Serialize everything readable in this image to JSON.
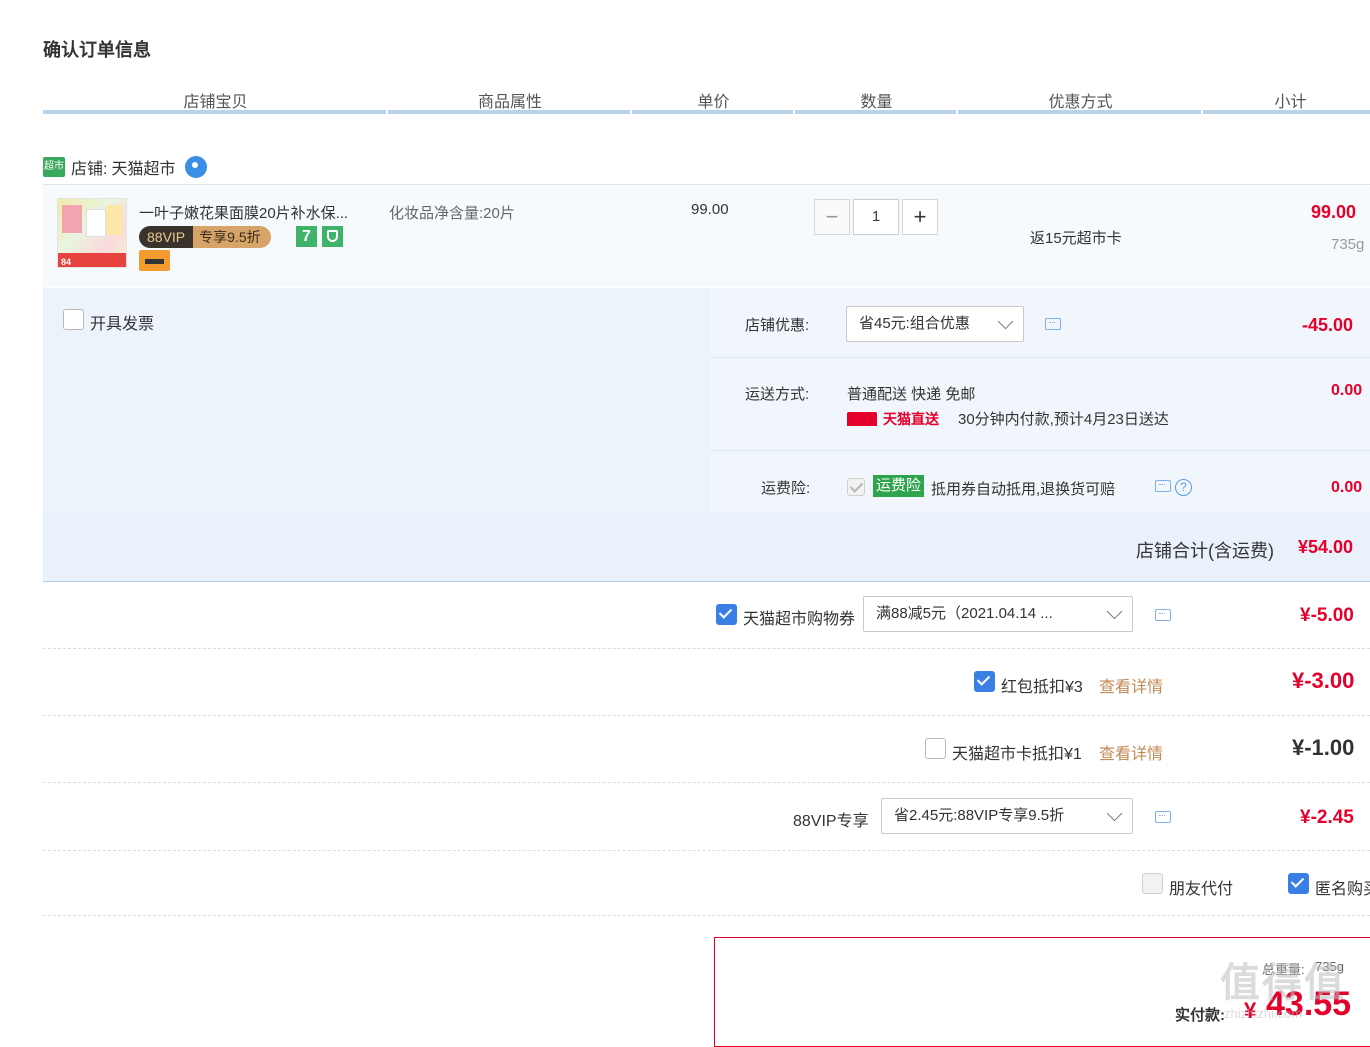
{
  "page_title": "确认订单信息",
  "columns": [
    "店铺宝贝",
    "商品属性",
    "单价",
    "数量",
    "优惠方式",
    "小计"
  ],
  "shop": {
    "logo_text": "超市",
    "label": "店铺:",
    "name": "天猫超市"
  },
  "item": {
    "title": "一叶子嫩花果面膜20片补水保...",
    "vip_tag": "88VIP",
    "vip_discount": "专享9.5折",
    "badge_7": "7",
    "attribute": "化妆品净含量:20片",
    "unit_price": "99.00",
    "quantity": "1",
    "promo": "返15元超市卡",
    "subtotal": "99.00",
    "weight": "735g",
    "thumb_price": "84"
  },
  "invoice_label": "开具发票",
  "shop_discount": {
    "label": "店铺优惠:",
    "selected": "省45元:组合优惠",
    "amount": "-45.00"
  },
  "shipping": {
    "label": "运送方式:",
    "method": "普通配送 快递 免邮",
    "tmall_direct": "天猫直送",
    "eta": "30分钟内付款,预计4月23日送达",
    "amount": "0.00"
  },
  "insurance": {
    "label": "运费险:",
    "badge": "运费险",
    "text": "抵用券自动抵用,退换货可赔",
    "amount": "0.00"
  },
  "shop_total": {
    "label": "店铺合计(含运费)",
    "amount": "¥54.00"
  },
  "coupon": {
    "label": "天猫超市购物券",
    "selected": "满88减5元（2021.04.14 ...",
    "amount": "¥-5.00"
  },
  "redpacket": {
    "label": "红包抵扣¥3",
    "link": "查看详情",
    "amount": "¥-3.00"
  },
  "supermarket_card": {
    "label": "天猫超市卡抵扣¥1",
    "link": "查看详情",
    "amount": "¥-1.00"
  },
  "vip88": {
    "label": "88VIP专享",
    "selected": "省2.45元:88VIP专享9.5折",
    "amount": "¥-2.45"
  },
  "friend_pay": "朋友代付",
  "anonymous": "匿名购买",
  "pay": {
    "weight_label": "总重量:",
    "weight": "735g",
    "actual_label": "实付款:",
    "currency": "¥",
    "amount": "43.55"
  },
  "watermark": "值得值",
  "watermark_url": "zhizhizhi.com",
  "colors": {
    "price_red": "#e4002b",
    "header_line": "#b9d3ea",
    "checkbox_blue": "#3a7fe6",
    "link_tan": "#c38a55"
  }
}
